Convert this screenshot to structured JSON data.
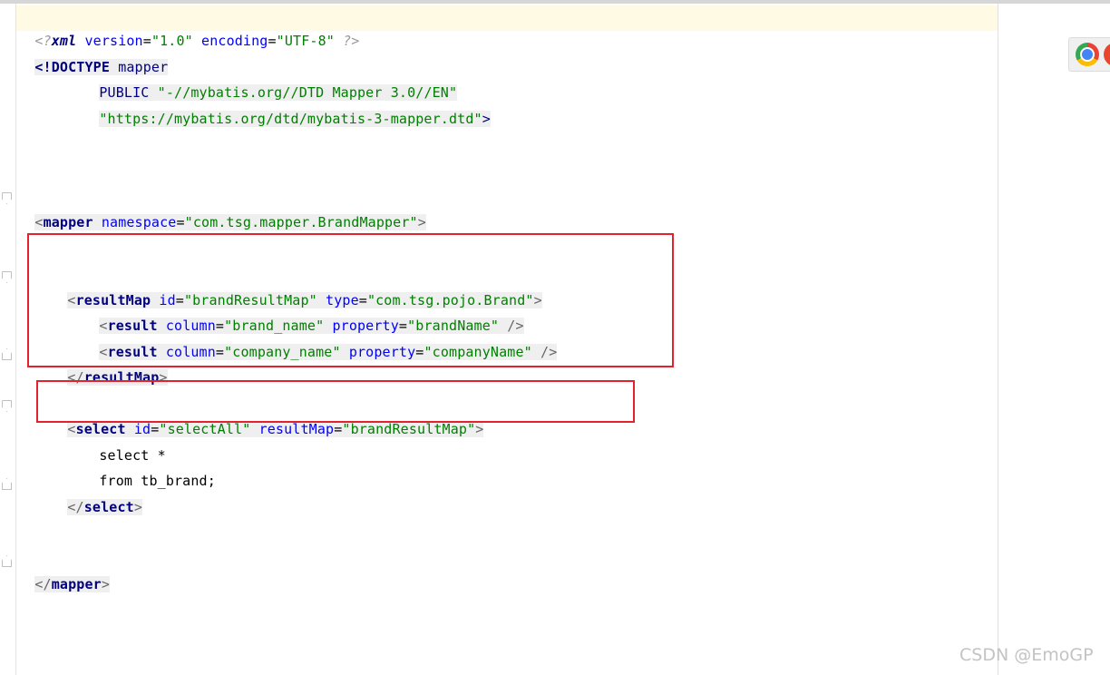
{
  "editor": {
    "lines": {
      "xml_decl": {
        "open": "<?",
        "kw": "xml",
        "a1": " version",
        "v1": "\"1.0\"",
        "a2": " encoding",
        "v2": "\"UTF-8\"",
        "close": " ?>"
      },
      "doctype": {
        "open": "<!DOCTYPE",
        "name": " mapper"
      },
      "public": {
        "kw": "PUBLIC",
        "value": "\"-//mybatis.org//DTD Mapper 3.0//EN\""
      },
      "dtd": {
        "value": "\"https://mybatis.org/dtd/mybatis-3-mapper.dtd\"",
        "close": ">"
      },
      "mapper_open": {
        "lt": "<",
        "tag": "mapper",
        "attr": " namespace",
        "eq": "=",
        "value": "\"com.tsg.mapper.BrandMapper\"",
        "gt": ">"
      },
      "resultmap_open": {
        "lt": "<",
        "tag": "resultMap",
        "a1": " id",
        "v1": "\"brandResultMap\"",
        "a2": " type",
        "v2": "\"com.tsg.pojo.Brand\"",
        "gt": ">"
      },
      "result1": {
        "lt": "<",
        "tag": "result",
        "a1": " column",
        "v1": "\"brand_name\"",
        "a2": " property",
        "v2": "\"brandName\"",
        "end": " />"
      },
      "result2": {
        "lt": "<",
        "tag": "result",
        "a1": " column",
        "v1": "\"company_name\"",
        "a2": " property",
        "v2": "\"companyName\"",
        "end": " />"
      },
      "resultmap_close": {
        "lt": "</",
        "tag": "resultMap",
        "gt": ">"
      },
      "select_open": {
        "lt": "<",
        "tag": "select",
        "a1": " id",
        "v1": "\"selectAll\"",
        "a2": " resultMap",
        "v2": "\"brandResultMap\"",
        "gt": ">"
      },
      "sql1": "select *",
      "sql2": "from tb_brand;",
      "select_close": {
        "lt": "</",
        "tag": "select",
        "gt": ">"
      },
      "mapper_close": {
        "lt": "</",
        "tag": "mapper",
        "gt": ">"
      }
    },
    "eq": "="
  },
  "colors": {
    "tag": "#000080",
    "attribute": "#0000ff",
    "string": "#008000",
    "highlight_box": "#e3222d",
    "current_line": "#fffae3"
  },
  "browser_icons": [
    "chrome-icon",
    "browser-icon"
  ],
  "watermark": "CSDN @EmoGP"
}
